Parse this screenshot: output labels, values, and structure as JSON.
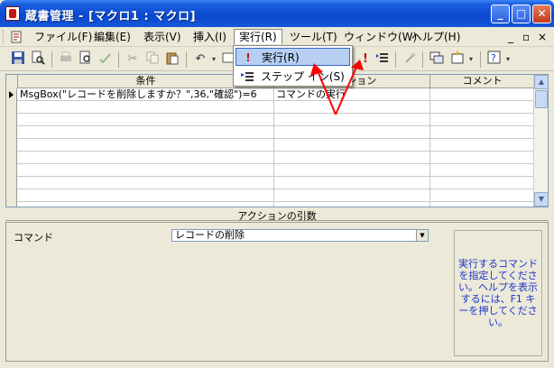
{
  "window": {
    "title": "蔵書管理 - [マクロ1 : マクロ]",
    "buttons": {
      "minimize": "_",
      "maximize": "□",
      "close": "✕"
    }
  },
  "menubar": {
    "items": [
      "ファイル(F)",
      "編集(E)",
      "表示(V)",
      "挿入(I)",
      "実行(R)",
      "ツール(T)",
      "ウィンドウ(W)",
      "ヘルプ(H)"
    ],
    "right_controls": [
      "_",
      "▫",
      "×"
    ]
  },
  "dropdown": {
    "items": [
      {
        "label": "実行(R)",
        "icon": "exclamation-icon"
      },
      {
        "label": "ステップ イン(S)",
        "icon": "step-in-icon"
      }
    ]
  },
  "grid": {
    "headers": [
      "条件",
      "アクション",
      "コメント"
    ],
    "rows": [
      {
        "condition": "MsgBox(\"レコードを削除しますか？\",36,\"確認\")=6",
        "action": "コマンドの実行",
        "comment": ""
      }
    ]
  },
  "args": {
    "title": "アクションの引数",
    "label": "コマンド",
    "value": "レコードの削除",
    "help": "実行するコマンドを指定してください。ヘルプを表示するには、F1 キーを押してください。"
  },
  "colors": {
    "arrow": "#ff0000",
    "help_text": "#1a34c8",
    "titlebar": "#0a48cf"
  }
}
